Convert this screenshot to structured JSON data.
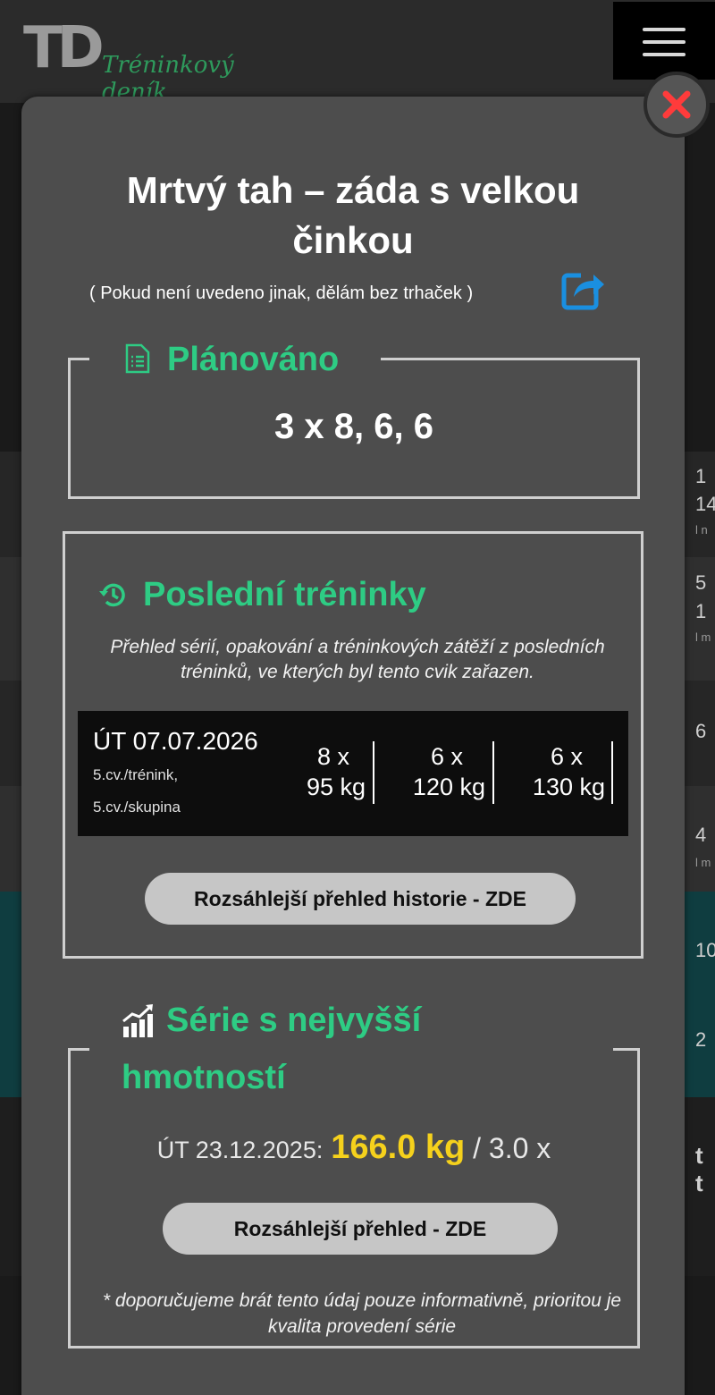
{
  "header": {
    "logo_mark": "TD",
    "logo_text": "Tréninkový deník"
  },
  "background": {
    "numbers": [
      "1",
      "14",
      "l n",
      "5",
      "1",
      "l m",
      "6",
      "4",
      "l m",
      "10",
      "2",
      "t t"
    ]
  },
  "modal": {
    "title": "Mrtvý tah – záda s velkou činkou",
    "subtitle": "( Pokud není uvedeno jinak, dělám bez trhaček )",
    "planned": {
      "heading": "Plánováno",
      "value": "3 x 8, 6, 6"
    },
    "last_trainings": {
      "heading": "Poslední tréninky",
      "description": "Přehled sérií, opakování a tréninkových zátěží z posledních tréninků, ve kterých byl tento cvik zařazen.",
      "entry": {
        "date": "ÚT 07.07.2026",
        "meta1": "5.cv./trénink,",
        "meta2": "5.cv./skupina",
        "sets": [
          {
            "reps": "8 x",
            "weight": "95 kg"
          },
          {
            "reps": "6 x",
            "weight": "120 kg"
          },
          {
            "reps": "6 x",
            "weight": "130 kg"
          }
        ]
      },
      "button": "Rozsáhlejší přehled historie - ZDE"
    },
    "max_weight": {
      "heading_line1": "Série s nejvyšší",
      "heading_line2": "hmotností",
      "date_prefix": "ÚT 23.12.2025:",
      "weight": "166.0 kg",
      "reps_suffix": "/ 3.0 x",
      "button": "Rozsáhlejší přehled - ZDE",
      "footnote": "* doporučujeme brát tento údaj pouze informativně, prioritou je kvalita provedení série"
    }
  },
  "colors": {
    "accent_green": "#2ecc84",
    "record_yellow": "#f5d11c",
    "close_red": "#ff3b3b",
    "share_blue": "#1a8fe0"
  },
  "icons": [
    "hamburger-icon",
    "close-icon",
    "share-icon",
    "document-icon",
    "history-icon",
    "chart-icon"
  ]
}
